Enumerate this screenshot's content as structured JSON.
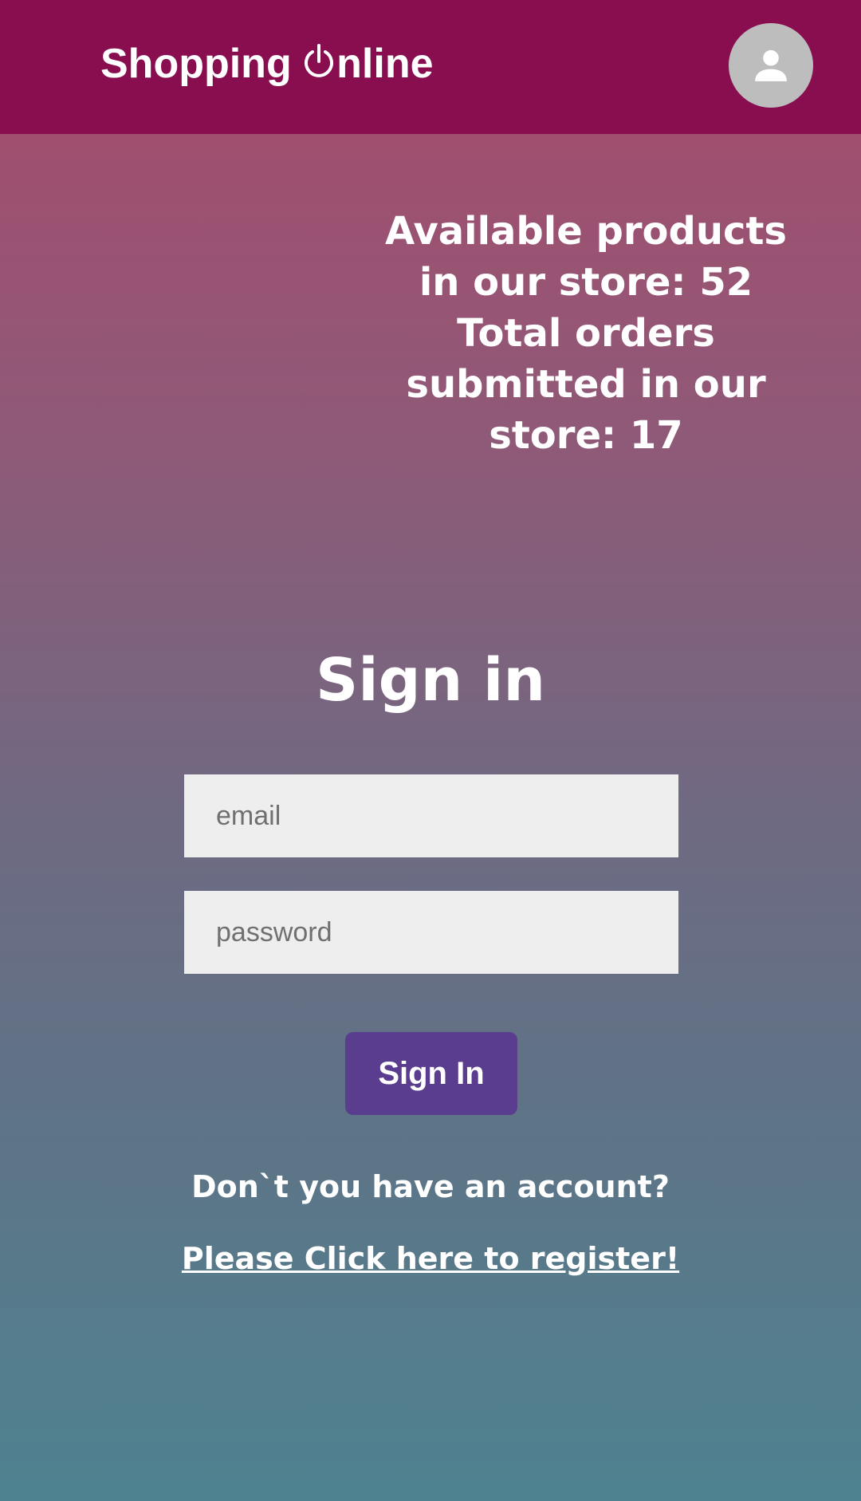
{
  "header": {
    "brand_prefix": "Shopping ",
    "brand_suffix": "nline",
    "brand_icon": "power-icon",
    "avatar_icon": "user-icon",
    "background_color": "#880e4f"
  },
  "stats": {
    "lines": [
      "Available products",
      "in our store: 52",
      "Total orders",
      "submitted in our",
      "store: 17"
    ]
  },
  "signin": {
    "title": "Sign in",
    "email_placeholder": "email",
    "password_placeholder": "password",
    "button_label": "Sign In",
    "button_color": "#5a3d8f",
    "no_account_text": "Don`t you have an account?",
    "register_link_text": "Please Click here to register!"
  }
}
